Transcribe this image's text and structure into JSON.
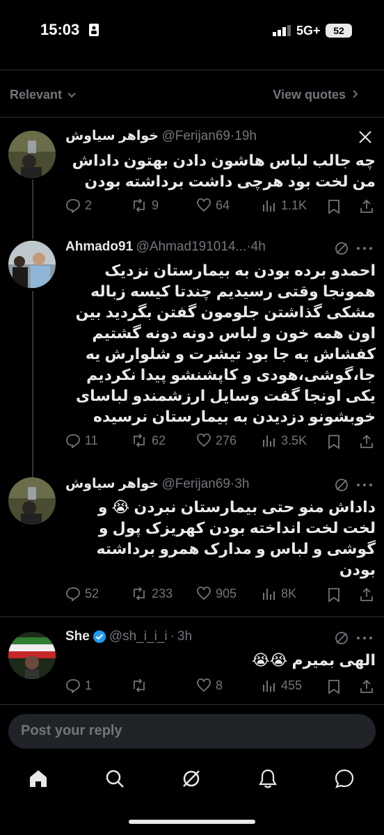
{
  "status_bar": {
    "time": "15:03",
    "network": "5G+",
    "battery": "52"
  },
  "filter": {
    "sort_label": "Relevant",
    "view_quotes": "View quotes"
  },
  "posts": [
    {
      "name": "خواهر سیاوش",
      "handle": "@Ferijan69",
      "time": "19h",
      "text": "چه جالب لباس هاشون دادن بهتون داداش من لخت بود هرچی داشت برداشته بودن",
      "replies": "2",
      "reposts": "9",
      "likes": "64",
      "views": "1.1K"
    },
    {
      "name": "Ahmado91",
      "handle": "@Ahmad191014...",
      "time": "4h",
      "text": "احمدو برده بودن به بیمارستان نزدیک همونجا وقتی رسیدیم چندتا کیسه زباله مشکی گذاشتن جلومون گفتن بگردید بین اون همه خون و لباس دونه دونه گشتیم کفشاش یه جا بود تیشرت و شلوارش یه جا،گوشی،هودی و کاپشنشو پیدا نکردیم یکی اونجا گفت وسایل ارزشمندو لباسای خوبشونو دزدیدن به بیمارستان نرسیده",
      "replies": "11",
      "reposts": "62",
      "likes": "276",
      "views": "3.5K"
    },
    {
      "name": "خواهر سیاوش",
      "handle": "@Ferijan69",
      "time": "3h",
      "text": "داداش منو حتی بیمارستان نبردن 😭 و لخت لخت انداخته بودن کهریزک پول و گوشی و لباس و مدارک همرو برداشته بودن",
      "replies": "52",
      "reposts": "233",
      "likes": "905",
      "views": "8K"
    },
    {
      "name": "She",
      "handle": "@sh_i_i_i",
      "time": "3h",
      "text": "الهی بمیرم 😭😭",
      "replies": "1",
      "reposts": "",
      "likes": "8",
      "views": "455"
    }
  ],
  "reply_placeholder": "Post your reply",
  "nav": [
    "home-icon",
    "search-icon",
    "grok-icon",
    "notifications-icon",
    "messages-icon"
  ],
  "colors": {
    "background": "#000000",
    "muted": "#71767b",
    "verified": "#1d9bf0",
    "text": "#e7e9ea"
  }
}
